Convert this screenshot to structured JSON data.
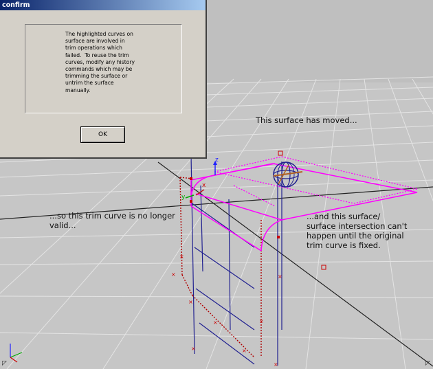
{
  "dialog": {
    "title": "confirm",
    "message": "The highlighted curves on\nsurface are involved in\ntrim operations which\nfailed.  To reuse the trim\ncurves, modify any history\ncommands which may be\ntrimming the surface or\nuntrim the surface\nmanually.",
    "ok_label": "OK"
  },
  "annotations": {
    "surface_moved": "This surface has moved...",
    "trim_curve": "...so this trim curve is no longer\nvalid...",
    "intersection": "...and this surface/\nsurface intersection can't\nhappen until the original\ntrim curve is fixed."
  },
  "axes": {
    "z": "z",
    "y": "y",
    "x": "x"
  },
  "colors": {
    "viewport_background": "#c6c6c6",
    "grid": "#e6e6e6",
    "curve_highlight": "#ff00ff",
    "curve_dark": "#202090",
    "error_curve": "#b00000"
  }
}
